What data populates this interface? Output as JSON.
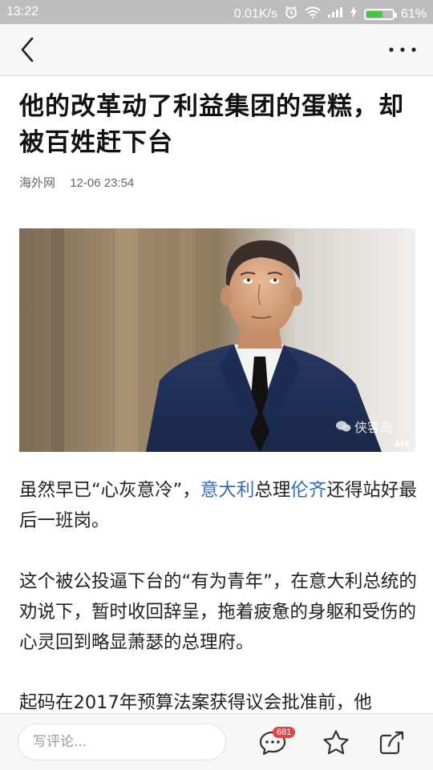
{
  "status_bar": {
    "time": "13:22",
    "network_speed": "0.01K/s",
    "battery_percent": "61%",
    "battery_level": 0.61,
    "icons": [
      "alarm-icon",
      "wifi-icon",
      "signal-icon",
      "charging-icon",
      "battery-icon"
    ]
  },
  "nav": {
    "back_icon": "chevron-left-icon",
    "more_icon": "more-dots-icon"
  },
  "article": {
    "title": "他的改革动了利益集团的蛋糕，却被百姓赶下台",
    "source": "海外网",
    "datetime": "12-06 23:54",
    "image": {
      "watermark": "侠客岛",
      "credit": "AFP"
    },
    "paragraphs": {
      "p1": {
        "t1": "虽然早已“心灰意冷”，",
        "link1": "意大利",
        "t2": "总理",
        "link2": "伦齐",
        "t3": "还得站好最后一班岗。"
      },
      "p2": "这个被公投逼下台的“有为青年”，在意大利总统的劝说下，暂时收回辞呈，拖着疲惫的身躯和受伤的心灵回到略显萧瑟的总理府。",
      "p3": "起码在2017年预算法案获得议会批准前，他"
    },
    "link_color": "#2f6db5"
  },
  "bottom_bar": {
    "comment_placeholder": "写评论...",
    "comment_count": "681",
    "icons": [
      "comment-icon",
      "star-icon",
      "share-icon"
    ]
  }
}
